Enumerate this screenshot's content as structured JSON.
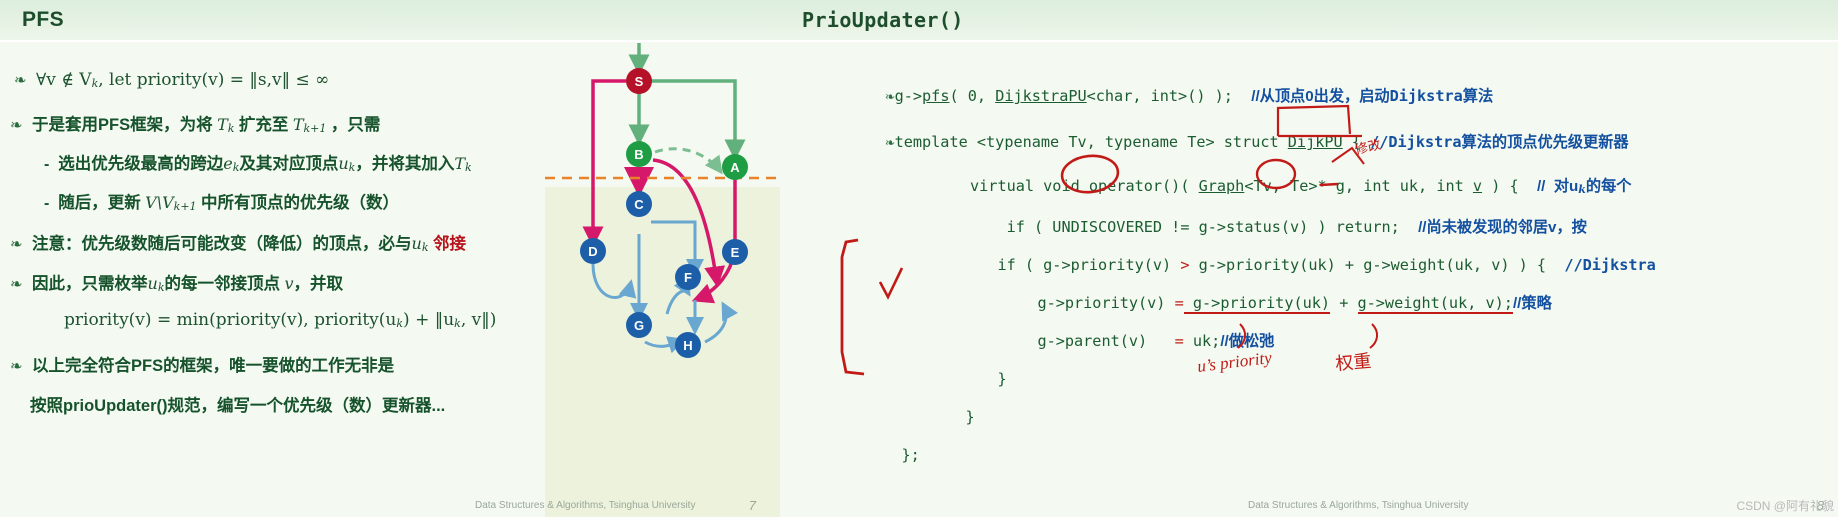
{
  "left": {
    "title": "PFS",
    "footer": "Data Structures & Algorithms, Tsinghua University",
    "page": "7",
    "bullets": {
      "b1": "∀v ∉ V",
      "b1_sub": "k",
      "b1_rest": ", let priority(v)  =  ‖s,v‖  ≤  ∞",
      "b2_a": "于是套用PFS框架，为将",
      "b2_m1": "T",
      "b2_m1s": "k",
      "b2_b": "扩充至",
      "b2_m2": "T",
      "b2_m2s": "k+1",
      "b2_c": "，只需",
      "b3_a": "选出优先级最高的跨边",
      "b3_m1": "e",
      "b3_m1s": "k",
      "b3_b": "及其对应顶点",
      "b3_m2": "u",
      "b3_m2s": "k",
      "b3_c": "，并将其加入",
      "b3_m3": "T",
      "b3_m3s": "k",
      "b4_a": "随后，更新",
      "b4_m": "V\\V",
      "b4_ms": "k+1",
      "b4_b": "中所有顶点的优先级（数）",
      "b5_a": "注意：优先级数随后可能改变（降低）的顶点，必与",
      "b5_m": "u",
      "b5_ms": "k",
      "b5_b": "邻接",
      "b6_a": "因此，只需枚举",
      "b6_m": "u",
      "b6_ms": "k",
      "b6_b": "的每一邻接顶点",
      "b6_m2": "v",
      "b6_c": "，并取",
      "b7": "priority(v)  =  min(priority(v), priority(u",
      "b7_s": "k",
      "b7_rest": ") + ‖u",
      "b7_s2": "k",
      "b7_rest2": ", v‖)",
      "b8": "以上完全符合PFS的框架，唯一要做的工作无非是",
      "b9": "按照prioUpdater()规范，编写一个优先级（数）更新器..."
    },
    "graph": {
      "nodes": [
        {
          "id": "S",
          "label": "S",
          "color": "#b5122a"
        },
        {
          "id": "B",
          "label": "B",
          "color": "#1f9d44"
        },
        {
          "id": "A",
          "label": "A",
          "color": "#1f9d44"
        },
        {
          "id": "D",
          "label": "D",
          "color": "#1c5fa8"
        },
        {
          "id": "C",
          "label": "C",
          "color": "#1c5fa8"
        },
        {
          "id": "E",
          "label": "E",
          "color": "#1c5fa8"
        },
        {
          "id": "F",
          "label": "F",
          "color": "#1c5fa8"
        },
        {
          "id": "G",
          "label": "G",
          "color": "#1c5fa8"
        },
        {
          "id": "H",
          "label": "H",
          "color": "#1c5fa8"
        }
      ],
      "frontier_color": "#e8832a",
      "tree_color": "#d6186a",
      "discovered_color": "#62b07c",
      "undiscovered_color": "#6aa7d0"
    }
  },
  "right": {
    "title": "PrioUpdater()",
    "footer": "Data Structures & Algorithms, Tsinghua University",
    "page": "8",
    "watermark": "CSDN @阿有礼貌",
    "lines": {
      "l1_code": "g->pfs( 0, DijkstraPU<char, int>() );",
      "l1_pfs": "pfs",
      "l1_dpu": "DijkstraPU",
      "l1_cmt": "//从顶点0出发，启动",
      "l1_cmt_red": "Dijkstra",
      "l1_cmt_end": "算法",
      "l2_code": "template <typename Tv, typename Te> struct DijkPU {",
      "l2_struct": "DijkPU",
      "l2_cmt": "//",
      "l2_cmt_red": "Dijkstra",
      "l2_cmt_end": "算法的顶点优先级更新器",
      "l3_code": "virtual void operator()( Graph<Tv, Te>* g, int uk, int v ) {",
      "l3_graph": "Graph",
      "l3_cmt": "//  对u",
      "l3_cmt_sub": "k",
      "l3_cmt_end": "的每个",
      "l4_code": "if ( UNDISCOVERED != g->status(v) ) return;",
      "l4_cmt": "//尚未被发现的邻居v，按",
      "l5_a": "if ( g->priority(v) ",
      "l5_op": ">",
      "l5_b": " g->priority(uk) + g->weight(uk, v) ) {",
      "l5_cmt": "//Dijkstra",
      "l6_a": "g->priority(v) ",
      "l6_op": "=",
      "l6_b": " g->priority(uk)",
      "l6_c": " + ",
      "l6_d": "g->weight(uk, v);",
      "l6_cmt": "//策略",
      "l7_a": "g->parent(v)   ",
      "l7_op": "=",
      "l7_b": " uk;",
      "l7_cmt": "//做松弛",
      "l8": "}",
      "l9": "}",
      "l10": "};",
      "ink_note1": "u’s priority",
      "ink_note2": "权重",
      "ink_note3": "修改"
    }
  }
}
